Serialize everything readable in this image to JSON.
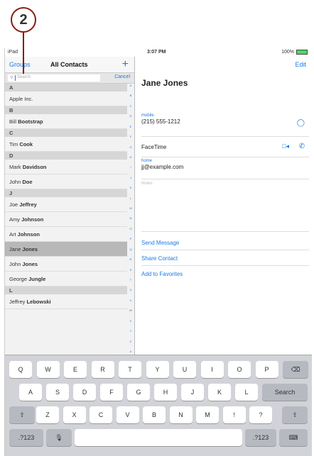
{
  "callout": {
    "number": "2"
  },
  "status": {
    "carrier": "iPad",
    "time": "3:07 PM",
    "battery": "100%"
  },
  "left_nav": {
    "groups": "Groups",
    "title": "All Contacts",
    "add": "+"
  },
  "search": {
    "placeholder": "Search",
    "cancel": "Cancel"
  },
  "contacts": [
    {
      "type": "section",
      "text": "A"
    },
    {
      "type": "contact",
      "first": "Apple Inc.",
      "last": ""
    },
    {
      "type": "section",
      "text": "B"
    },
    {
      "type": "contact",
      "first": "Bill ",
      "last": "Bootstrap"
    },
    {
      "type": "section",
      "text": "C"
    },
    {
      "type": "contact",
      "first": "Tim ",
      "last": "Cook"
    },
    {
      "type": "section",
      "text": "D"
    },
    {
      "type": "contact",
      "first": "Mark ",
      "last": "Davidson"
    },
    {
      "type": "contact",
      "first": "John ",
      "last": "Doe"
    },
    {
      "type": "section",
      "text": "J"
    },
    {
      "type": "contact",
      "first": "Joe ",
      "last": "Jeffrey"
    },
    {
      "type": "contact",
      "first": "Amy ",
      "last": "Johnson"
    },
    {
      "type": "contact",
      "first": "Art ",
      "last": "Johnson"
    },
    {
      "type": "contact",
      "first": "Jane ",
      "last": "Jones",
      "selected": true
    },
    {
      "type": "contact",
      "first": "John ",
      "last": "Jones"
    },
    {
      "type": "contact",
      "first": "George ",
      "last": "Jungle"
    },
    {
      "type": "section",
      "text": "L"
    },
    {
      "type": "contact",
      "first": "Jeffrey ",
      "last": "Lebowski"
    }
  ],
  "index_letters": [
    "A",
    "B",
    "C",
    "D",
    "E",
    "F",
    "G",
    "H",
    "I",
    "J",
    "K",
    "L",
    "M",
    "N",
    "O",
    "P",
    "Q",
    "R",
    "S",
    "T",
    "U",
    "V",
    "W",
    "X",
    "Y",
    "Z",
    "#"
  ],
  "detail": {
    "edit": "Edit",
    "name": "Jane Jones",
    "mobile_label": "mobile",
    "mobile": "(215) 555-1212",
    "facetime": "FaceTime",
    "home_label": "home",
    "email": "jj@example.com",
    "notes_label": "Notes",
    "send_message": "Send Message",
    "share_contact": "Share Contact",
    "add_favorites": "Add to Favorites"
  },
  "keyboard": {
    "row1": [
      "Q",
      "W",
      "E",
      "R",
      "T",
      "Y",
      "U",
      "I",
      "O",
      "P",
      "⌫"
    ],
    "row2": [
      "A",
      "S",
      "D",
      "F",
      "G",
      "H",
      "J",
      "K",
      "L",
      "Search"
    ],
    "row3": [
      "⇧",
      "Z",
      "X",
      "C",
      "V",
      "B",
      "N",
      "M",
      "!",
      "?",
      "⇧"
    ],
    "row4": [
      ".?123",
      "🎙",
      "",
      ".?123",
      "⌨"
    ]
  }
}
